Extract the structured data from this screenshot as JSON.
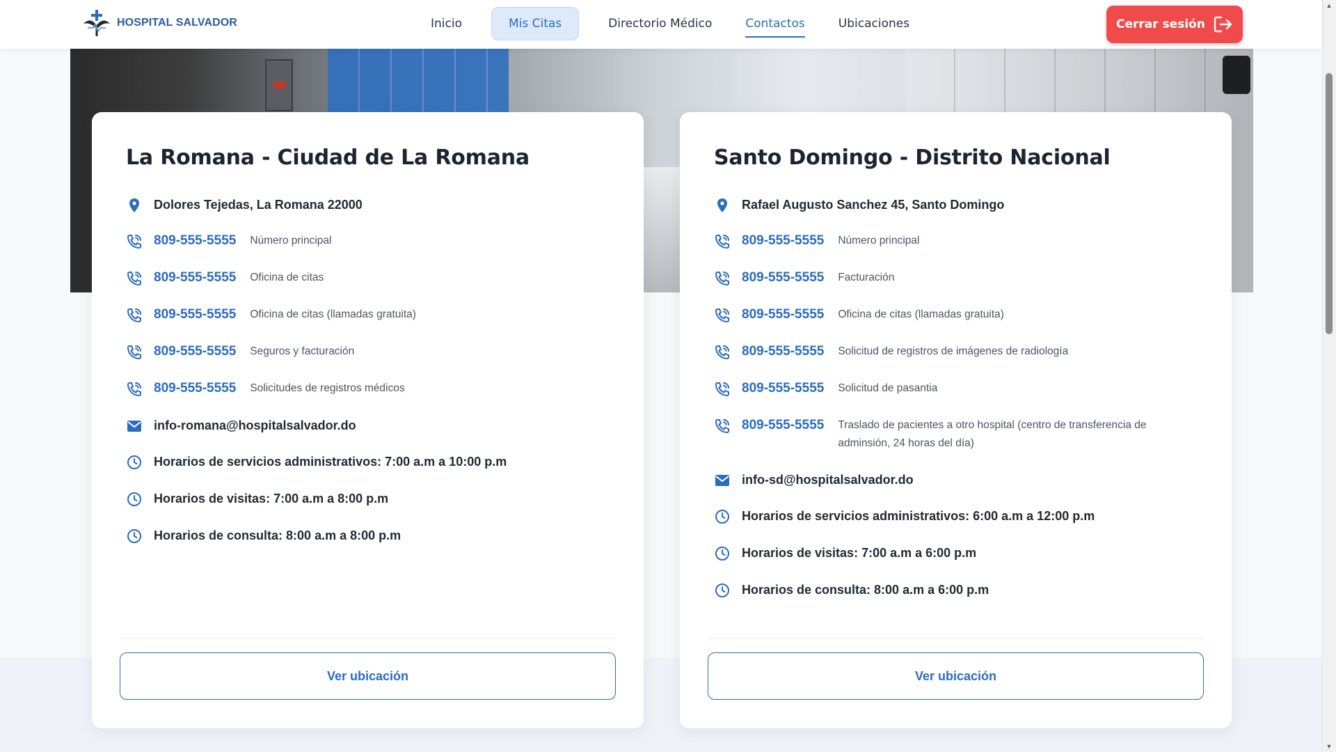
{
  "brand": {
    "name": "HOSPITAL SALVADOR"
  },
  "nav": {
    "items": [
      {
        "label": "Inicio"
      },
      {
        "label": "Mis Citas"
      },
      {
        "label": "Directorio Médico"
      },
      {
        "label": "Contactos"
      },
      {
        "label": "Ubicaciones"
      }
    ],
    "logout_label": "Cerrar sesión"
  },
  "locations": [
    {
      "title": "La Romana - Ciudad de La Romana",
      "address": "Dolores Tejedas, La Romana 22000",
      "phones": [
        {
          "number": "809-555-5555",
          "desc": "Número principal"
        },
        {
          "number": "809-555-5555",
          "desc": "Oficina de citas"
        },
        {
          "number": "809-555-5555",
          "desc": "Oficina de citas (llamadas gratuita)"
        },
        {
          "number": "809-555-5555",
          "desc": "Seguros y facturación"
        },
        {
          "number": "809-555-5555",
          "desc": "Solicitudes de registros médicos"
        }
      ],
      "email": "info-romana@hospitalsalvador.do",
      "hours": [
        "Horarios de servicios administrativos: 7:00 a.m a 10:00 p.m",
        "Horarios de visitas: 7:00 a.m a 8:00 p.m",
        "Horarios de consulta: 8:00 a.m a 8:00 p.m"
      ],
      "button_label": "Ver ubicación"
    },
    {
      "title": "Santo Domingo - Distrito Nacional",
      "address": "Rafael Augusto Sanchez 45, Santo Domingo",
      "phones": [
        {
          "number": "809-555-5555",
          "desc": "Número principal"
        },
        {
          "number": "809-555-5555",
          "desc": "Facturación"
        },
        {
          "number": "809-555-5555",
          "desc": "Oficina de citas (llamadas gratuita)"
        },
        {
          "number": "809-555-5555",
          "desc": "Solicitud de registros de imágenes de radiología"
        },
        {
          "number": "809-555-5555",
          "desc": "Solicitud de pasantia"
        },
        {
          "number": "809-555-5555",
          "desc": "Traslado de pacientes a otro hospital (centro de transferencia de adminsión, 24 horas del día)"
        }
      ],
      "email": "info-sd@hospitalsalvador.do",
      "hours": [
        "Horarios de servicios administrativos: 6:00 a.m a 12:00 p.m",
        "Horarios de visitas: 7:00 a.m a 6:00 p.m",
        "Horarios de consulta: 8:00 a.m a 6:00 p.m"
      ],
      "button_label": "Ver ubicación"
    }
  ],
  "colors": {
    "primary": "#2a6bbf",
    "logout": "#ef4b4b",
    "nav_active_bg": "#dceaf9"
  },
  "icons": {
    "address": "map-pin-icon",
    "phone": "phone-call-icon",
    "email": "mail-icon",
    "hours": "clock-icon",
    "logout": "logout-icon"
  }
}
